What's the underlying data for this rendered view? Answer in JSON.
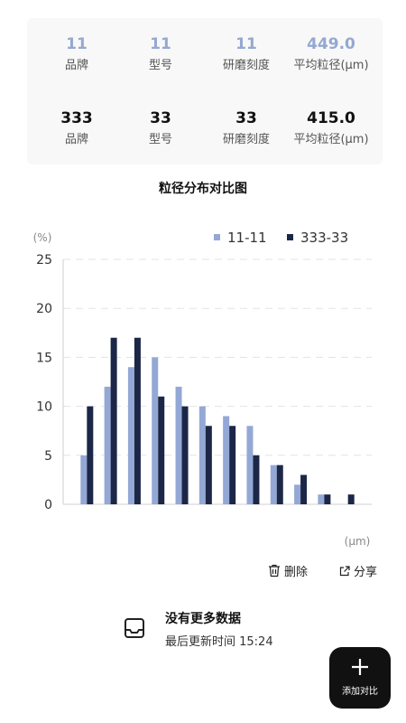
{
  "compare_rows": [
    {
      "brand": "11",
      "model": "11",
      "grind": "11",
      "size": "449.0"
    },
    {
      "brand": "333",
      "model": "33",
      "grind": "33",
      "size": "415.0"
    }
  ],
  "labels": {
    "brand": "品牌",
    "model": "型号",
    "grind": "研磨刻度",
    "size": "平均粒径(μm)"
  },
  "actions": {
    "delete": "删除",
    "share": "分享"
  },
  "empty": {
    "title": "没有更多数据",
    "subtitle": "最后更新时间 15:24"
  },
  "fab": {
    "label": "添加对比"
  },
  "colors": {
    "series1": "#94a8d6",
    "series2": "#1c2747",
    "grid": "#e3e3e3",
    "axis": "#cfcfcf"
  },
  "chart_data": {
    "type": "bar",
    "title": "粒径分布对比图",
    "ylabel": "(%)",
    "xlabel": "(μm)",
    "ylim": [
      0,
      25
    ],
    "yticks": [
      0,
      5,
      10,
      15,
      20,
      25
    ],
    "grid": true,
    "legend_position": "top-right",
    "categories": [
      "",
      "",
      "",
      "",
      "",
      "",
      "",
      "",
      "",
      "",
      "",
      ""
    ],
    "series": [
      {
        "name": "11-11",
        "values": [
          5,
          12,
          14,
          15,
          12,
          10,
          9,
          8,
          4,
          2,
          1,
          0
        ]
      },
      {
        "name": "333-33",
        "values": [
          10,
          17,
          17,
          11,
          10,
          8,
          8,
          5,
          4,
          3,
          1,
          1
        ]
      }
    ]
  }
}
